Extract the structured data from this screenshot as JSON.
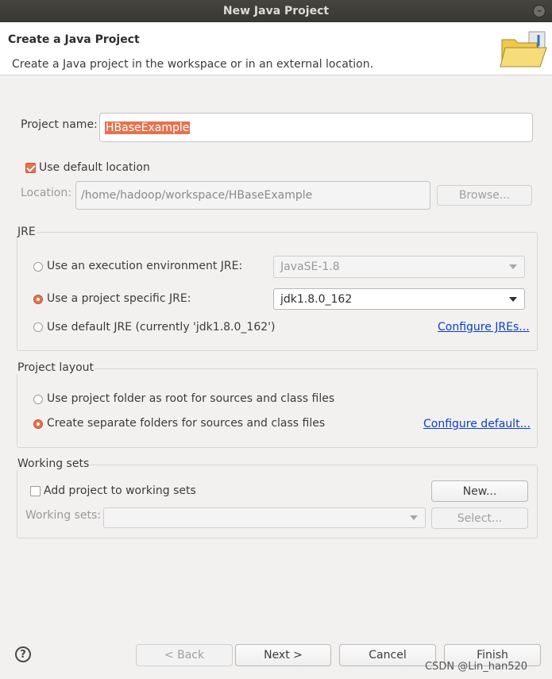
{
  "window": {
    "title": "New Java Project"
  },
  "header": {
    "title": "Create a Java Project",
    "description": "Create a Java project in the workspace or in an external location.",
    "icon": "folder-icon"
  },
  "project": {
    "name_label": "Project name:",
    "name_value": "HBaseExample",
    "use_default_location_label": "Use default location",
    "use_default_location_checked": true,
    "location_label": "Location:",
    "location_value": "/home/hadoop/workspace/HBaseExample",
    "browse_label": "Browse..."
  },
  "jre": {
    "group_label": "JRE",
    "options": [
      {
        "label": "Use an execution environment JRE:",
        "checked": false
      },
      {
        "label": "Use a project specific JRE:",
        "checked": true
      },
      {
        "label": "Use default JRE (currently 'jdk1.8.0_162')",
        "checked": false
      }
    ],
    "execution_env_value": "JavaSE-1.8",
    "project_jre_value": "jdk1.8.0_162",
    "configure_link": "Configure JREs..."
  },
  "layout": {
    "group_label": "Project layout",
    "options": [
      {
        "label": "Use project folder as root for sources and class files",
        "checked": false
      },
      {
        "label": "Create separate folders for sources and class files",
        "checked": true
      }
    ],
    "configure_link": "Configure default..."
  },
  "working_sets": {
    "group_label": "Working sets",
    "add_label": "Add project to working sets",
    "add_checked": false,
    "new_label": "New...",
    "sets_label": "Working sets:",
    "sets_value": "",
    "select_label": "Select..."
  },
  "footer": {
    "back_label": "< Back",
    "next_label": "Next >",
    "cancel_label": "Cancel",
    "finish_label": "Finish",
    "help_symbol": "?"
  },
  "watermark": "CSDN @Lin_han520",
  "colors": {
    "accent": "#e5724e",
    "link": "#0b3ec7",
    "titlebar": "#3c3b37"
  }
}
